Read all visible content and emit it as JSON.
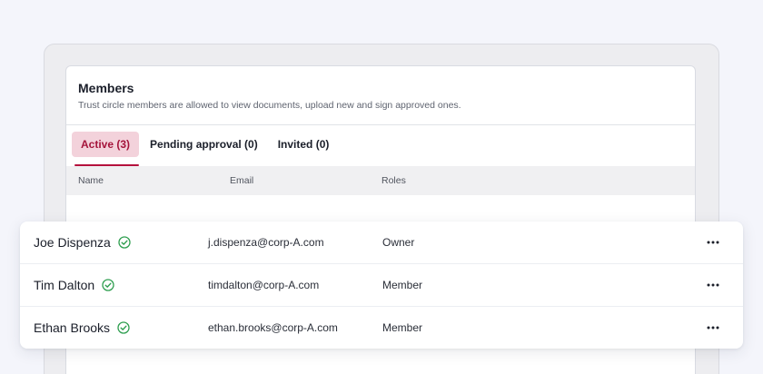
{
  "panel": {
    "title": "Members",
    "subtitle": "Trust circle members are allowed to view documents, upload new and sign approved ones."
  },
  "tabs": [
    {
      "label": "Active (3)",
      "active": true
    },
    {
      "label": "Pending approval (0)",
      "active": false
    },
    {
      "label": "Invited (0)",
      "active": false
    }
  ],
  "table": {
    "columns": [
      "Name",
      "Email",
      "Roles"
    ],
    "rows": [
      {
        "name": "Joe Dispenza",
        "email": "j.dispenza@corp-A.com",
        "role": "Owner",
        "verified": true,
        "menu_icon": "more-horizontal-icon"
      },
      {
        "name": "Tim Dalton",
        "email": "timdalton@corp-A.com",
        "role": "Member",
        "verified": true,
        "menu_icon": "more-horizontal-icon"
      },
      {
        "name": "Ethan Brooks",
        "email": "ethan.brooks@corp-A.com",
        "role": "Member",
        "verified": true,
        "menu_icon": "more-horizontal-icon"
      }
    ]
  },
  "colors": {
    "accent": "#b5113c",
    "active_tab_bg": "#f3d2db",
    "verified_green": "#2e9e4f"
  }
}
